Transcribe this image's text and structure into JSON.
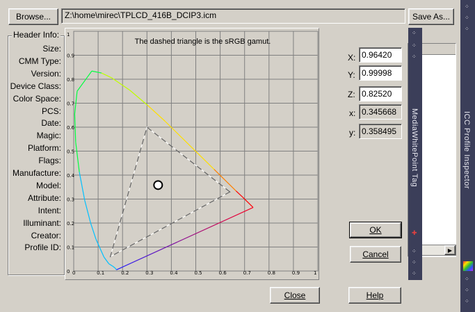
{
  "toolbar": {
    "browse_label": "Browse...",
    "path": "Z:\\home\\mirec\\TPLCD_416B_DCIP3.icm",
    "save_as_label": "Save As..."
  },
  "header_info": {
    "title": "Header Info:",
    "fields": [
      "Size:",
      "CMM Type:",
      "Version:",
      "Device Class:",
      "Color Space:",
      "PCS:",
      "Date:",
      "Magic:",
      "Platform:",
      "Flags:",
      "Manufacture:",
      "Model:",
      "Attribute:",
      "Intent:",
      "Illuminant:",
      "Creator:",
      "Profile ID:"
    ]
  },
  "chart_data": {
    "type": "scatter",
    "title": "The dashed triangle is the sRGB gamut.",
    "xlim": [
      0,
      1
    ],
    "ylim": [
      0,
      1
    ],
    "x_ticks": [
      "0",
      "0.1",
      "0.2",
      "0.3",
      "0.4",
      "0.5",
      "0.6",
      "0.7",
      "0.8",
      "0.9",
      "1"
    ],
    "y_ticks": [
      "0",
      "0.1",
      "0.2",
      "0.3",
      "0.4",
      "0.5",
      "0.6",
      "0.7",
      "0.8",
      "0.9",
      "1"
    ],
    "grid": true,
    "spectral_locus": [
      [
        0.175,
        0.005
      ],
      [
        0.17,
        0.012
      ],
      [
        0.16,
        0.02
      ],
      [
        0.144,
        0.03
      ],
      [
        0.124,
        0.058
      ],
      [
        0.091,
        0.133
      ],
      [
        0.069,
        0.201
      ],
      [
        0.045,
        0.295
      ],
      [
        0.023,
        0.413
      ],
      [
        0.008,
        0.538
      ],
      [
        0.004,
        0.655
      ],
      [
        0.014,
        0.75
      ],
      [
        0.074,
        0.834
      ],
      [
        0.114,
        0.826
      ],
      [
        0.155,
        0.806
      ],
      [
        0.23,
        0.754
      ],
      [
        0.302,
        0.692
      ],
      [
        0.374,
        0.625
      ],
      [
        0.444,
        0.555
      ],
      [
        0.512,
        0.487
      ],
      [
        0.575,
        0.424
      ],
      [
        0.627,
        0.372
      ],
      [
        0.665,
        0.334
      ],
      [
        0.692,
        0.308
      ],
      [
        0.735,
        0.265
      ]
    ],
    "srgb_gamut": [
      [
        0.64,
        0.33
      ],
      [
        0.3,
        0.6
      ],
      [
        0.15,
        0.06
      ]
    ],
    "white_point": [
      0.345668,
      0.358495
    ]
  },
  "white_point_panel": {
    "X_label": "X:",
    "X_value": "0.96420",
    "Y_label": "Y:",
    "Y_value": "0.99998",
    "Z_label": "Z:",
    "Z_value": "0.82520",
    "x_label": "x:",
    "x_value": "0.345668",
    "y_label": "y:",
    "y_value": "0.358495",
    "ok_label": "OK",
    "cancel_label": "Cancel"
  },
  "tag_side_title": "MediaWhitePoint Tag",
  "app_side_title": "ICC Profile Inspector",
  "footer": {
    "close_label": "Close",
    "help_label": "Help"
  }
}
